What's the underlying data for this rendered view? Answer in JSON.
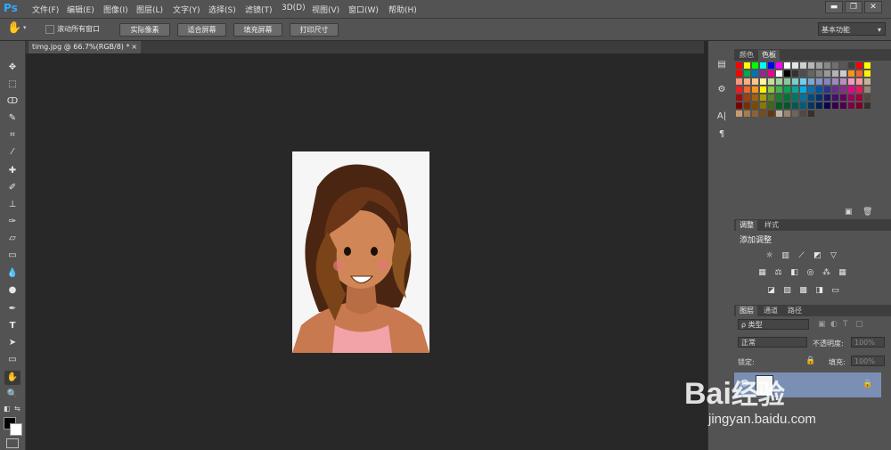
{
  "app": {
    "logo": "Ps"
  },
  "menu": [
    "文件(F)",
    "编辑(E)",
    "图像(I)",
    "图层(L)",
    "文字(Y)",
    "选择(S)",
    "滤镜(T)",
    "3D(D)",
    "视图(V)",
    "窗口(W)",
    "帮助(H)"
  ],
  "window_buttons": [
    "▬",
    "❐",
    "✕"
  ],
  "options": {
    "scroll_all_label": "滚动所有窗口",
    "buttons": [
      "实际像素",
      "适合屏幕",
      "填充屏幕",
      "打印尺寸"
    ],
    "workspace": "基本功能"
  },
  "document": {
    "tab_title": "timg.jpg @ 66.7%(RGB/8) *",
    "close": "×"
  },
  "panels": {
    "color_tabs": [
      "颜色",
      "色板"
    ],
    "adjust_tabs": [
      "调整",
      "样式"
    ],
    "adjust_title": "添加调整",
    "layers_tabs": [
      "图层",
      "通道",
      "路径"
    ],
    "kind_label": "ρ 类型",
    "blend_mode": "正常",
    "opacity_label": "不透明度:",
    "opacity_value": "100%",
    "lock_label": "锁定:",
    "fill_label": "填充:",
    "fill_value": "100%"
  },
  "icons": {
    "hand": "hand-icon",
    "zoom": "zoom-icon",
    "lock": "lock-icon"
  },
  "watermark": {
    "brand": "Bai",
    "brand2": "经验",
    "url": "jingyan.baidu.com"
  },
  "colors": {
    "accent": "#31a8ff",
    "panel": "#535353",
    "canvas_bg": "#282828"
  }
}
